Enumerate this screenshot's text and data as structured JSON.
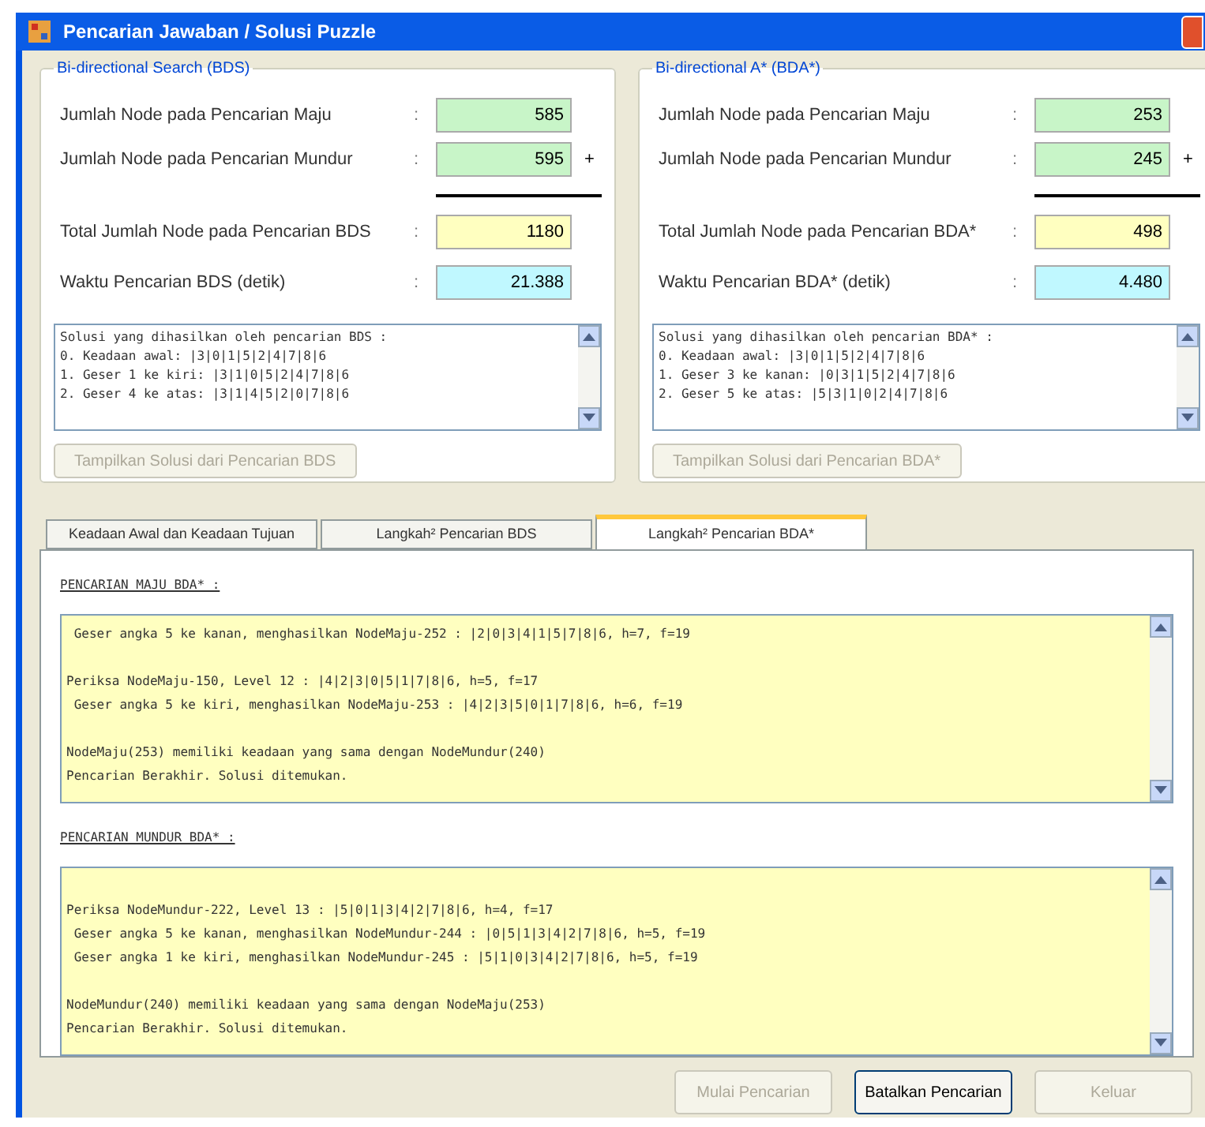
{
  "window": {
    "title": "Pencarian Jawaban / Solusi Puzzle"
  },
  "panels": [
    {
      "title": "Bi-directional Search (BDS)",
      "rows": [
        {
          "label": "Jumlah Node pada Pencarian Maju",
          "separator": ":",
          "kind": "count",
          "value": "585"
        },
        {
          "label": "Jumlah Node pada Pencarian Mundur",
          "separator": ":",
          "kind": "count",
          "value": "595",
          "suffix": "+"
        },
        {
          "label": "Total Jumlah Node pada Pencarian BDS",
          "separator": ":",
          "kind": "total",
          "value": "1180"
        },
        {
          "label": "Waktu Pencarian BDS (detik)",
          "separator": ":",
          "kind": "time",
          "value": "21.388"
        }
      ],
      "solution_lines": [
        "Solusi yang dihasilkan oleh pencarian BDS :",
        "0. Keadaan awal: |3|0|1|5|2|4|7|8|6",
        "1. Geser 1 ke kiri: |3|1|0|5|2|4|7|8|6",
        "2. Geser 4 ke atas: |3|1|4|5|2|0|7|8|6"
      ],
      "button": {
        "label": "Tampilkan Solusi dari Pencarian BDS",
        "disabled": true
      }
    },
    {
      "title": "Bi-directional A* (BDA*)",
      "rows": [
        {
          "label": "Jumlah Node pada Pencarian Maju",
          "separator": ":",
          "kind": "count",
          "value": "253"
        },
        {
          "label": "Jumlah Node pada Pencarian Mundur",
          "separator": ":",
          "kind": "count",
          "value": "245",
          "suffix": "+"
        },
        {
          "label": "Total Jumlah Node pada Pencarian BDA*",
          "separator": ":",
          "kind": "total",
          "value": "498"
        },
        {
          "label": "Waktu Pencarian BDA* (detik)",
          "separator": ":",
          "kind": "time",
          "value": "4.480"
        }
      ],
      "solution_lines": [
        "Solusi yang dihasilkan oleh pencarian BDA* :",
        "0. Keadaan awal: |3|0|1|5|2|4|7|8|6",
        "1. Geser 3 ke kanan: |0|3|1|5|2|4|7|8|6",
        "2. Geser 5 ke atas: |5|3|1|0|2|4|7|8|6"
      ],
      "button": {
        "label": "Tampilkan Solusi dari Pencarian BDA*",
        "disabled": true
      }
    }
  ],
  "tabs": [
    {
      "label": "Keadaan Awal dan Keadaan Tujuan",
      "selected": false
    },
    {
      "label": "Langkah² Pencarian BDS",
      "selected": false
    },
    {
      "label": "Langkah² Pencarian BDA*",
      "selected": true
    }
  ],
  "sections": [
    {
      "heading": "PENCARIAN MAJU BDA* :",
      "leading_blank": false,
      "paragraphs": [
        [
          " Geser angka 5 ke kanan, menghasilkan NodeMaju-252 : |2|0|3|4|1|5|7|8|6, h=7, f=19"
        ],
        [
          "Periksa NodeMaju-150, Level 12 : |4|2|3|0|5|1|7|8|6, h=5, f=17",
          " Geser angka 5 ke kiri, menghasilkan NodeMaju-253 : |4|2|3|5|0|1|7|8|6, h=6, f=19"
        ],
        [
          "NodeMaju(253) memiliki keadaan yang sama dengan NodeMundur(240)",
          "Pencarian Berakhir. Solusi ditemukan."
        ]
      ]
    },
    {
      "heading": "PENCARIAN MUNDUR BDA* :",
      "leading_blank": true,
      "paragraphs": [
        [
          "Periksa NodeMundur-222, Level 13 : |5|0|1|3|4|2|7|8|6, h=4, f=17",
          " Geser angka 5 ke kanan, menghasilkan NodeMundur-244 : |0|5|1|3|4|2|7|8|6, h=5, f=19",
          " Geser angka 1 ke kiri, menghasilkan NodeMundur-245 : |5|1|0|3|4|2|7|8|6, h=5, f=19"
        ],
        [
          "NodeMundur(240) memiliki keadaan yang sama dengan NodeMaju(253)",
          "Pencarian Berakhir. Solusi ditemukan."
        ]
      ]
    }
  ],
  "buttons": [
    {
      "label": "Mulai Pencarian",
      "disabled": true
    },
    {
      "label": "Batalkan Pencarian",
      "disabled": false
    },
    {
      "label": "Keluar",
      "disabled": true
    }
  ]
}
